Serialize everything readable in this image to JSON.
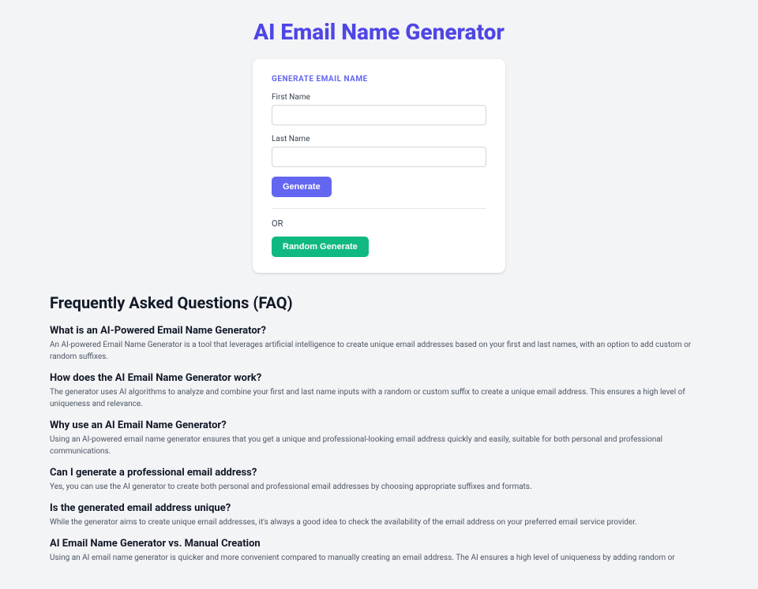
{
  "title": "AI Email Name Generator",
  "card": {
    "header": "GENERATE EMAIL NAME",
    "first_label": "First Name",
    "last_label": "Last Name",
    "generate": "Generate",
    "or": "OR",
    "random": "Random Generate"
  },
  "faq_title": "Frequently Asked Questions (FAQ)",
  "faq": [
    {
      "q": "What is an AI-Powered Email Name Generator?",
      "a": "An AI-powered Email Name Generator is a tool that leverages artificial intelligence to create unique email addresses based on your first and last names, with an option to add custom or random suffixes."
    },
    {
      "q": "How does the AI Email Name Generator work?",
      "a": "The generator uses AI algorithms to analyze and combine your first and last name inputs with a random or custom suffix to create a unique email address. This ensures a high level of uniqueness and relevance."
    },
    {
      "q": "Why use an AI Email Name Generator?",
      "a": "Using an AI-powered email name generator ensures that you get a unique and professional-looking email address quickly and easily, suitable for both personal and professional communications."
    },
    {
      "q": "Can I generate a professional email address?",
      "a": "Yes, you can use the AI generator to create both personal and professional email addresses by choosing appropriate suffixes and formats."
    },
    {
      "q": "Is the generated email address unique?",
      "a": "While the generator aims to create unique email addresses, it's always a good idea to check the availability of the email address on your preferred email service provider."
    },
    {
      "q": "AI Email Name Generator vs. Manual Creation",
      "a": "Using an AI email name generator is quicker and more convenient compared to manually creating an email address. The AI ensures a high level of uniqueness by adding random or"
    }
  ]
}
